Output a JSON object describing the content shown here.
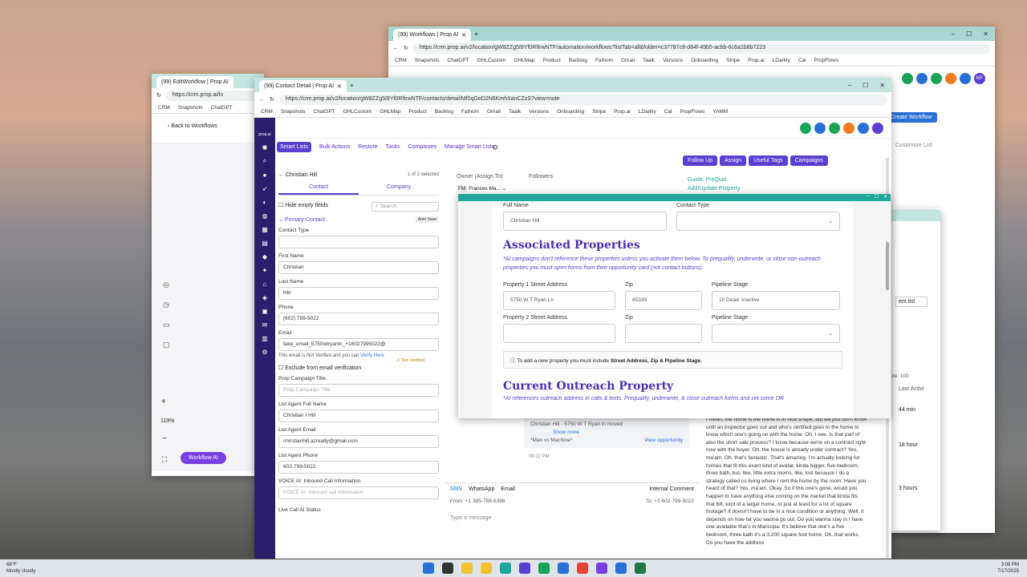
{
  "back_window": {
    "tab": "(99) Workflows | Prop AI",
    "url": "https://crm.prop.ai/v2/location/gW8ZZg5I9Yf0RfIrwNTF/automation/workflows?listTab=all&folder=c37787c8-d84f-49b5-acbb-6c6a1b8b7223",
    "bookmarks": [
      "CRM",
      "Snapshots",
      "ChatGPT",
      "GHLCustom",
      "GHLMap",
      "Product",
      "Backlog",
      "Fathom",
      "Gmail",
      "Taalk",
      "Versions",
      "Onboarding",
      "Stripe",
      "Prop.ai",
      "LDarkly",
      "Cal",
      "PropFlows"
    ],
    "create_workflow": "Create Workflow",
    "customize_list": "Customize List",
    "content_list": "ent list",
    "size": "ize: 100",
    "last_activity": "Last Activi",
    "times": [
      "44 min",
      "18 hour",
      "3 hours"
    ],
    "avatar": "MF"
  },
  "edit_window": {
    "tab": "(99) EditWorkflow | Prop AI",
    "url": "https://crm.prop.ai/lo",
    "bookmarks": [
      "CRM",
      "Snapshots",
      "ChatGPT"
    ],
    "back": "Back to Workflows",
    "zoom": "119%",
    "workflow_ai": "Workflow AI"
  },
  "contact_window": {
    "tab": "(99) Contact Detail | Prop AI",
    "url": "https://crm.prop.ai/v2/location/gW8ZZg5I9Yf0RfIrwNTF/contacts/detail/Mf0qGeD2N6KmhXanCZzS?view=note",
    "bookmarks": [
      "CRM",
      "Snapshots",
      "ChatGPT",
      "GHLCustom",
      "GHLMap",
      "Product",
      "Backlog",
      "Fathom",
      "Gmail",
      "Taalk",
      "Versions",
      "Onboarding",
      "Stripe",
      "Prop.ai",
      "LDarkly",
      "Cal",
      "PropFlows",
      "YAMM"
    ],
    "brand": "prop.ai",
    "nav": [
      "Smart Lists",
      "Bulk Actions",
      "Restore",
      "Tasks",
      "Companies",
      "Manage Smart Lists"
    ],
    "contact_name": "Christian Hill",
    "pager": "1 of  2  selected",
    "tabs": [
      "Contact",
      "Company"
    ],
    "hide_empty": "Hide empty fields",
    "search_ph": "Search",
    "primary": "Primary Contact",
    "autosave": "Auto Save",
    "fields": [
      {
        "label": "Contact Type",
        "value": ""
      },
      {
        "label": "First Name",
        "value": "Christian"
      },
      {
        "label": "Last Name",
        "value": "Hill"
      },
      {
        "label": "Phone",
        "value": "(602) 799-5022"
      },
      {
        "label": "Email",
        "value": "fake_email_5750wtryanln_+16027995022@"
      }
    ],
    "not_verified": "Not Verified",
    "verify_note": "This email is Not Verified and you can",
    "verify_link": "Verify Here",
    "exclude": "Exclude from email verification",
    "fields2": [
      {
        "label": "Prop Campaign Title",
        "value": "Prop Campaign Title",
        "ph": true
      },
      {
        "label": "List Agent Full Name",
        "value": "Christian I Hill"
      },
      {
        "label": "List Agent Email",
        "value": "christianhill.azrealty@gmail.com"
      },
      {
        "label": "List Agent Phone",
        "value": "602-799-5022"
      },
      {
        "label": "VOICE AI: Inbound Call Information",
        "value": "VOICE AI: Inbound call information",
        "ph": true
      }
    ],
    "live_call": "Live Call AI Status",
    "owner": "Owner (Assign To)",
    "owner_val": "Frances Ma...",
    "followers": "Followers",
    "actions": [
      "Follow Up",
      "Assign",
      "Useful Tags",
      "Campaigns"
    ],
    "guide": "Guide: PreQual",
    "addprop": "Add/Update Property",
    "chat_snip": "Christian Hill - 5750 W T Ryan ln moved",
    "show_more": "Show more",
    "man_machine": "*Man vs Machine*",
    "view_opp": "View opportunity",
    "time": "08:22 PM",
    "msg_tabs": [
      "SMS",
      "WhatsApp",
      "Email"
    ],
    "internal": "Internal Comment",
    "from": "From:  +1 385-786-6388",
    "to": "To:  +1 602-799-5022",
    "type_msg": "Type a message",
    "transcript": "I mean, the home is the home is in nice shape, but we just don't know until an inspector goes out and who's certified goes to the home to know which one's going on with the home. Oh, I see. Is that part of also the short sale process? I know because we're on a contract right now with the buyer. Oh, the house is already under contract? Yes, ma'am. Oh, that's fantastic. That's amazing. I'm actually looking for homes that fit this exact kind of avatar, kinda bigger, five bedroom, three bath, but, like, little extra rooms, like, lost because I do a strategy called co living where I rent the home by the room. Have you heard of that? Yes, ma'am. Okay. So if this one's gone, would you happen to have anything else coming on the market that kinda fits that bill, kind of a larger home, or just at least for a lot of square footage? It doesn't have to be in a nice condition or anything. Well, it depends on how far you wanna go out. Do you wanna stay in I have one available that's in Maricopa. It's believe that one's a five bedroom, three bath it's a 3,200 square foot home. Oh, that works. Do you have the address"
  },
  "modal": {
    "full_name_label": "Full Name",
    "full_name": "Christian Hill",
    "contact_type": "Contact Type",
    "assoc_title": "Associated Properties",
    "assoc_note": "*AI campaigns don't reference these properties unless you activate them below. To prequalify, underwrite, or close non-outreach properties you must open forms from their opportunity card (not contact buttons).",
    "p1_addr_label": "Property 1 Street Address",
    "p1_addr": "5750 W T Ryan Ln",
    "zip_label": "Zip",
    "p1_zip": "85339",
    "stage_label": "Pipeline Stage",
    "p1_stage": "10 Dead: Inactive",
    "p2_addr_label": "Property 2 Street Address",
    "add_note": "To add a new property you must include",
    "add_note_bold": "Street Address, Zip & Pipeline Stage.",
    "outreach_title": "Current Outreach Property",
    "outreach_note": "*AI references outreach address in calls & texts. Prequalify, underwrite, & close outreach forms and set some OR"
  },
  "taskbar": {
    "temp": "68°F",
    "weather": "Mostly cloudy",
    "time": "3:08 PM",
    "date": "7/17/2025"
  },
  "colors": {
    "teal": "#1fa89a",
    "purple": "#5a3fd1",
    "navy": "#2b1e6b",
    "link": "#2a6fd6"
  }
}
